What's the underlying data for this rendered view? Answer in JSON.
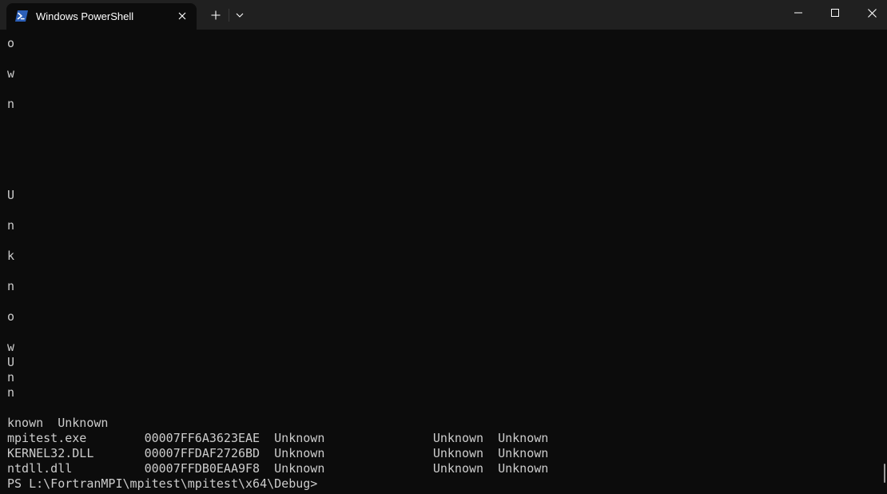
{
  "window": {
    "tab_title": "Windows PowerShell",
    "tab_icon": "powershell-icon",
    "icons": {
      "close_tab": "close-icon",
      "new_tab": "plus-icon",
      "dropdown": "chevron-down-icon",
      "minimize": "minimize-icon",
      "maximize": "maximize-icon",
      "close_window": "close-icon"
    },
    "accent_color": "#2b5fb8"
  },
  "console": {
    "background": "#0c0c0c",
    "foreground": "#cccccc",
    "lines": [
      "o",
      "w",
      "n",
      "U",
      "n",
      "k",
      "n",
      "o",
      "w",
      "U",
      "n",
      "n",
      "known  Unknown",
      "mpitest.exe        00007FF6A3623EAE  Unknown               Unknown  Unknown",
      "KERNEL32.DLL       00007FFDAF2726BD  Unknown               Unknown  Unknown",
      "ntdll.dll          00007FFDB0EAA9F8  Unknown               Unknown  Unknown",
      "PS L:\\FortranMPI\\mpitest\\mpitest\\x64\\Debug>"
    ]
  }
}
